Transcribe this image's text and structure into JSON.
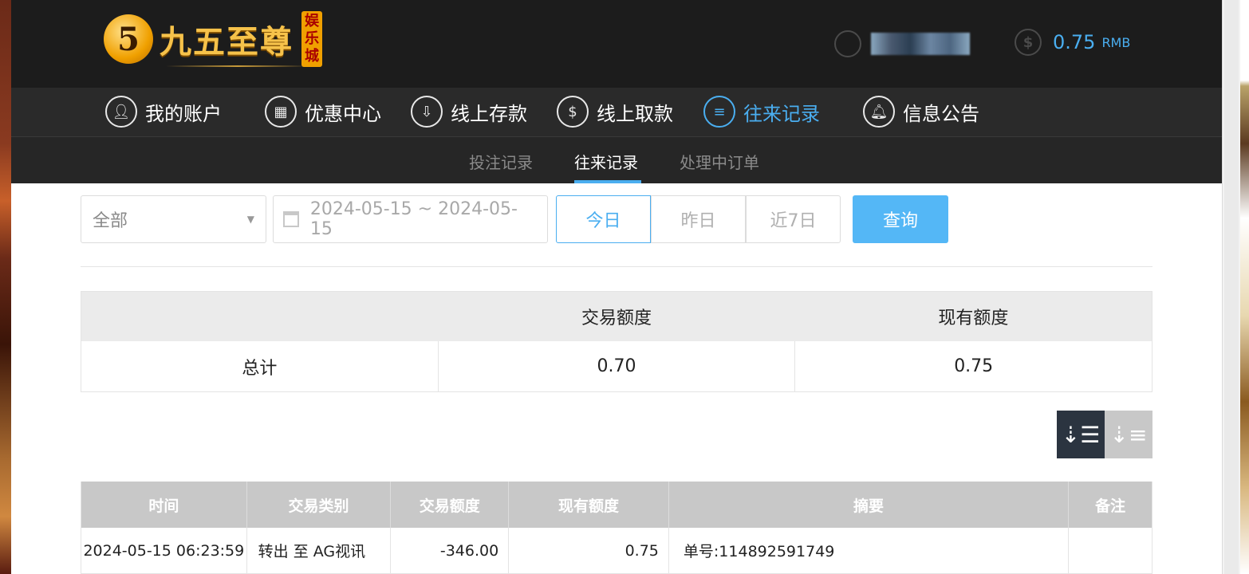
{
  "header": {
    "logo_mark": "5",
    "logo_text": "九五至尊",
    "logo_sub": "娱乐城",
    "balance_value": "0.75",
    "balance_unit": "RMB"
  },
  "mainnav": [
    {
      "label": "我的账户",
      "icon": "user-icon"
    },
    {
      "label": "优惠中心",
      "icon": "gift-icon"
    },
    {
      "label": "线上存款",
      "icon": "deposit-icon"
    },
    {
      "label": "线上取款",
      "icon": "withdraw-icon"
    },
    {
      "label": "往来记录",
      "icon": "records-icon",
      "active": true
    },
    {
      "label": "信息公告",
      "icon": "bell-icon"
    }
  ],
  "subnav": [
    {
      "label": "投注记录"
    },
    {
      "label": "往来记录",
      "active": true
    },
    {
      "label": "处理中订单"
    }
  ],
  "filter": {
    "type_value": "全部",
    "date_range": "2024-05-15 ~ 2024-05-15",
    "quick_ranges": [
      "今日",
      "昨日",
      "近7日"
    ],
    "query_label": "查询"
  },
  "summary": {
    "headers": [
      "",
      "交易额度",
      "现有额度"
    ],
    "row": [
      "总计",
      "0.70",
      "0.75"
    ]
  },
  "records": {
    "headers": [
      "时间",
      "交易类别",
      "交易额度",
      "现有额度",
      "摘要",
      "备注"
    ],
    "rows": [
      [
        "2024-05-15 06:23:59",
        "转出 至 AG视讯",
        "-346.00",
        "0.75",
        "单号:114892591749",
        ""
      ]
    ]
  },
  "colors": {
    "accent": "#4aaef0",
    "header_bg": "#1c1c1c",
    "nav_bg": "#2a2a2a",
    "query_button": "#54b7f6"
  }
}
